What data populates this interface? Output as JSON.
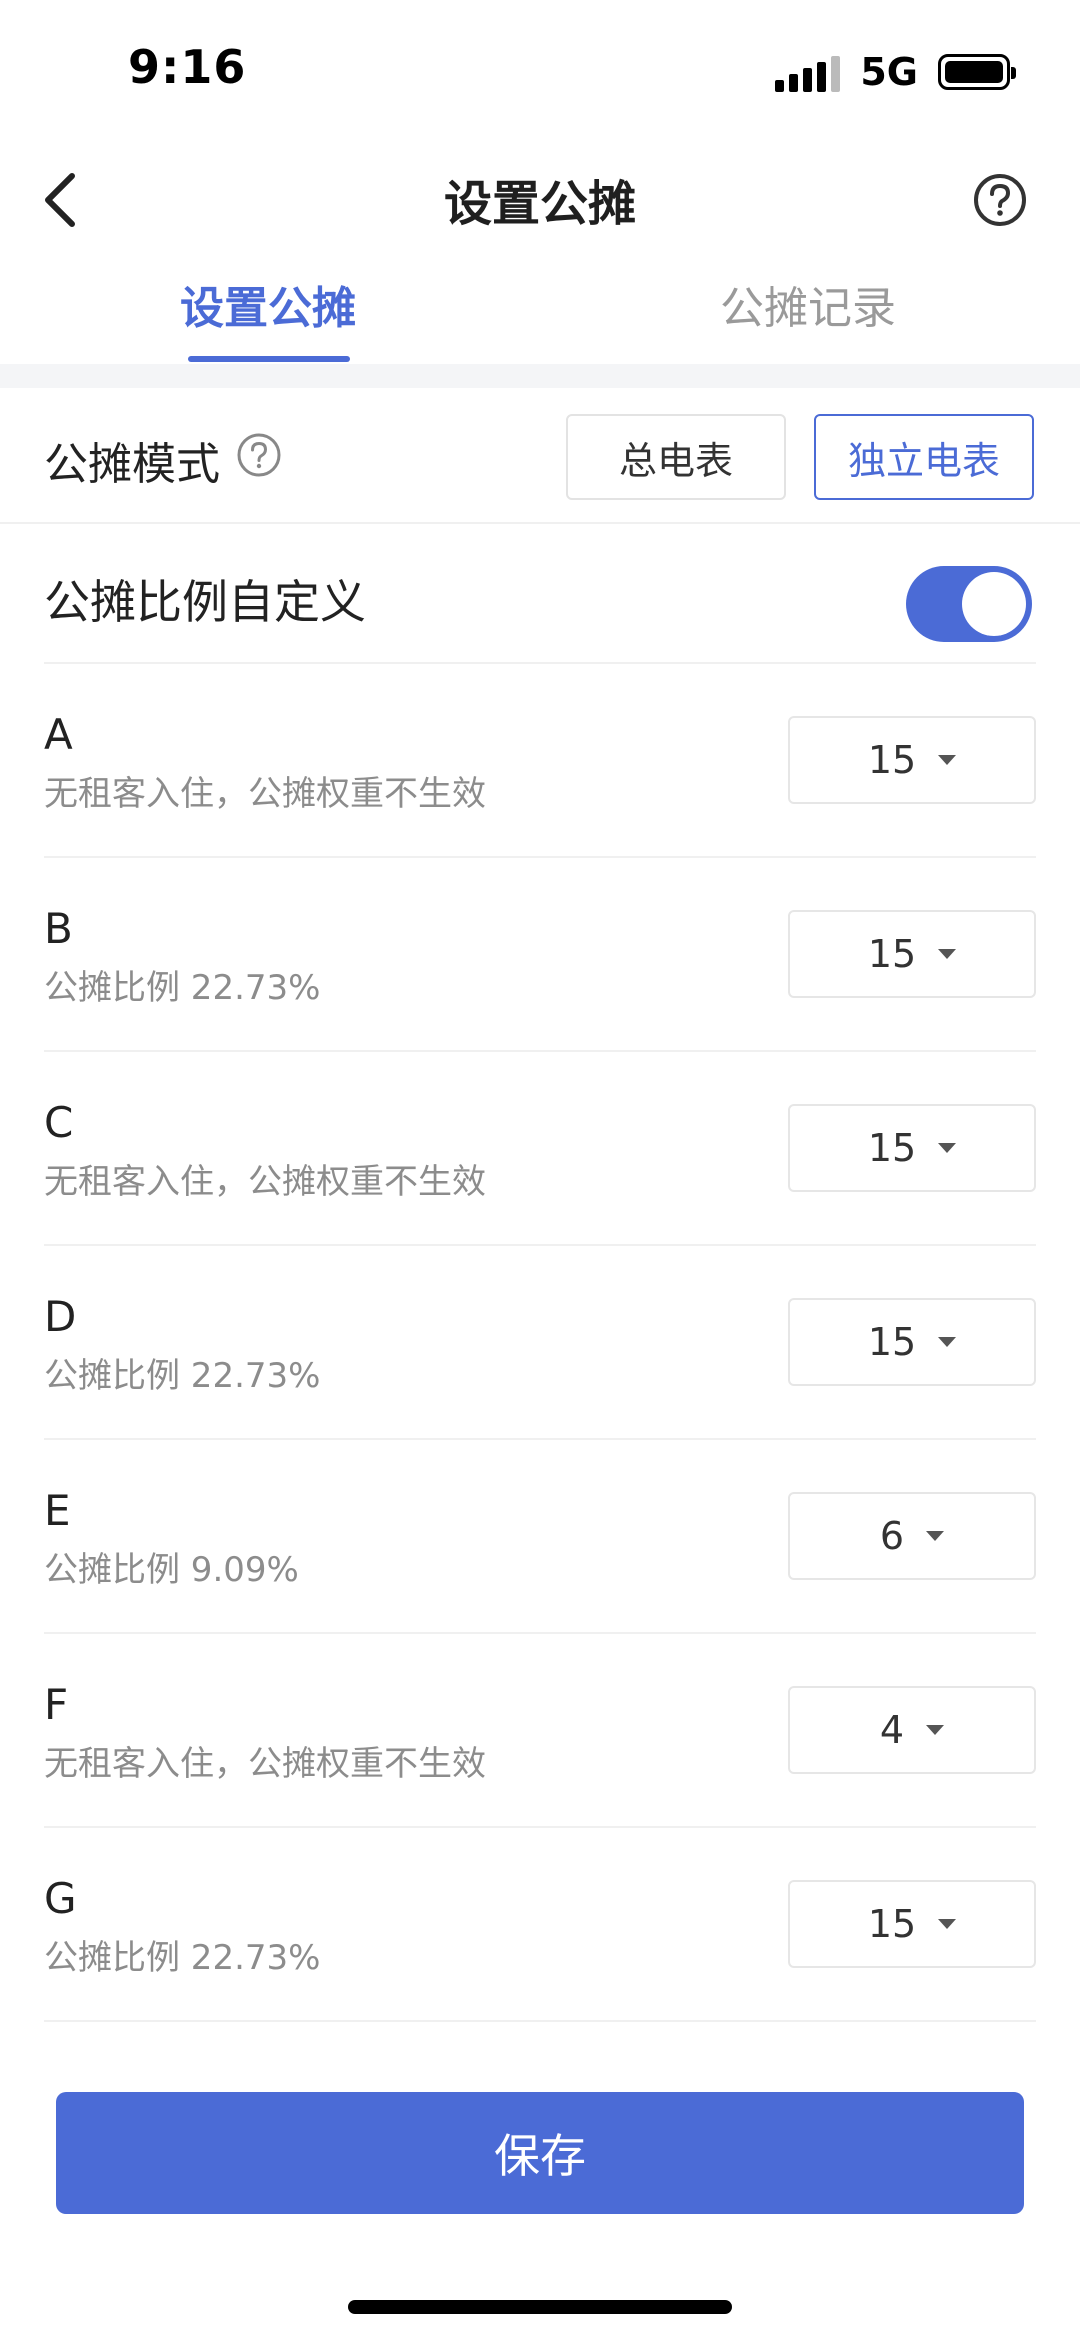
{
  "status_bar": {
    "time": "9:16",
    "network": "5G"
  },
  "nav": {
    "title": "设置公摊"
  },
  "tabs": [
    {
      "label": "设置公摊",
      "active": true
    },
    {
      "label": "公摊记录",
      "active": false
    }
  ],
  "mode": {
    "label": "公摊模式",
    "options": [
      {
        "label": "总电表",
        "selected": false
      },
      {
        "label": "独立电表",
        "selected": true
      }
    ]
  },
  "custom_ratio": {
    "label": "公摊比例自定义",
    "enabled": true
  },
  "rooms": [
    {
      "name": "A",
      "desc": "无租客入住，公摊权重不生效",
      "weight": "15"
    },
    {
      "name": "B",
      "desc": "公摊比例 22.73%",
      "weight": "15"
    },
    {
      "name": "C",
      "desc": "无租客入住，公摊权重不生效",
      "weight": "15"
    },
    {
      "name": "D",
      "desc": "公摊比例 22.73%",
      "weight": "15"
    },
    {
      "name": "E",
      "desc": "公摊比例 9.09%",
      "weight": "6"
    },
    {
      "name": "F",
      "desc": "无租客入住，公摊权重不生效",
      "weight": "4"
    },
    {
      "name": "G",
      "desc": "公摊比例 22.73%",
      "weight": "15"
    }
  ],
  "save_label": "保存",
  "colors": {
    "accent": "#4b6bd6",
    "muted_text": "#8c8c8c"
  },
  "icons": {
    "back": "chevron-left-icon",
    "help": "question-circle-icon",
    "caret": "caret-down-icon"
  }
}
